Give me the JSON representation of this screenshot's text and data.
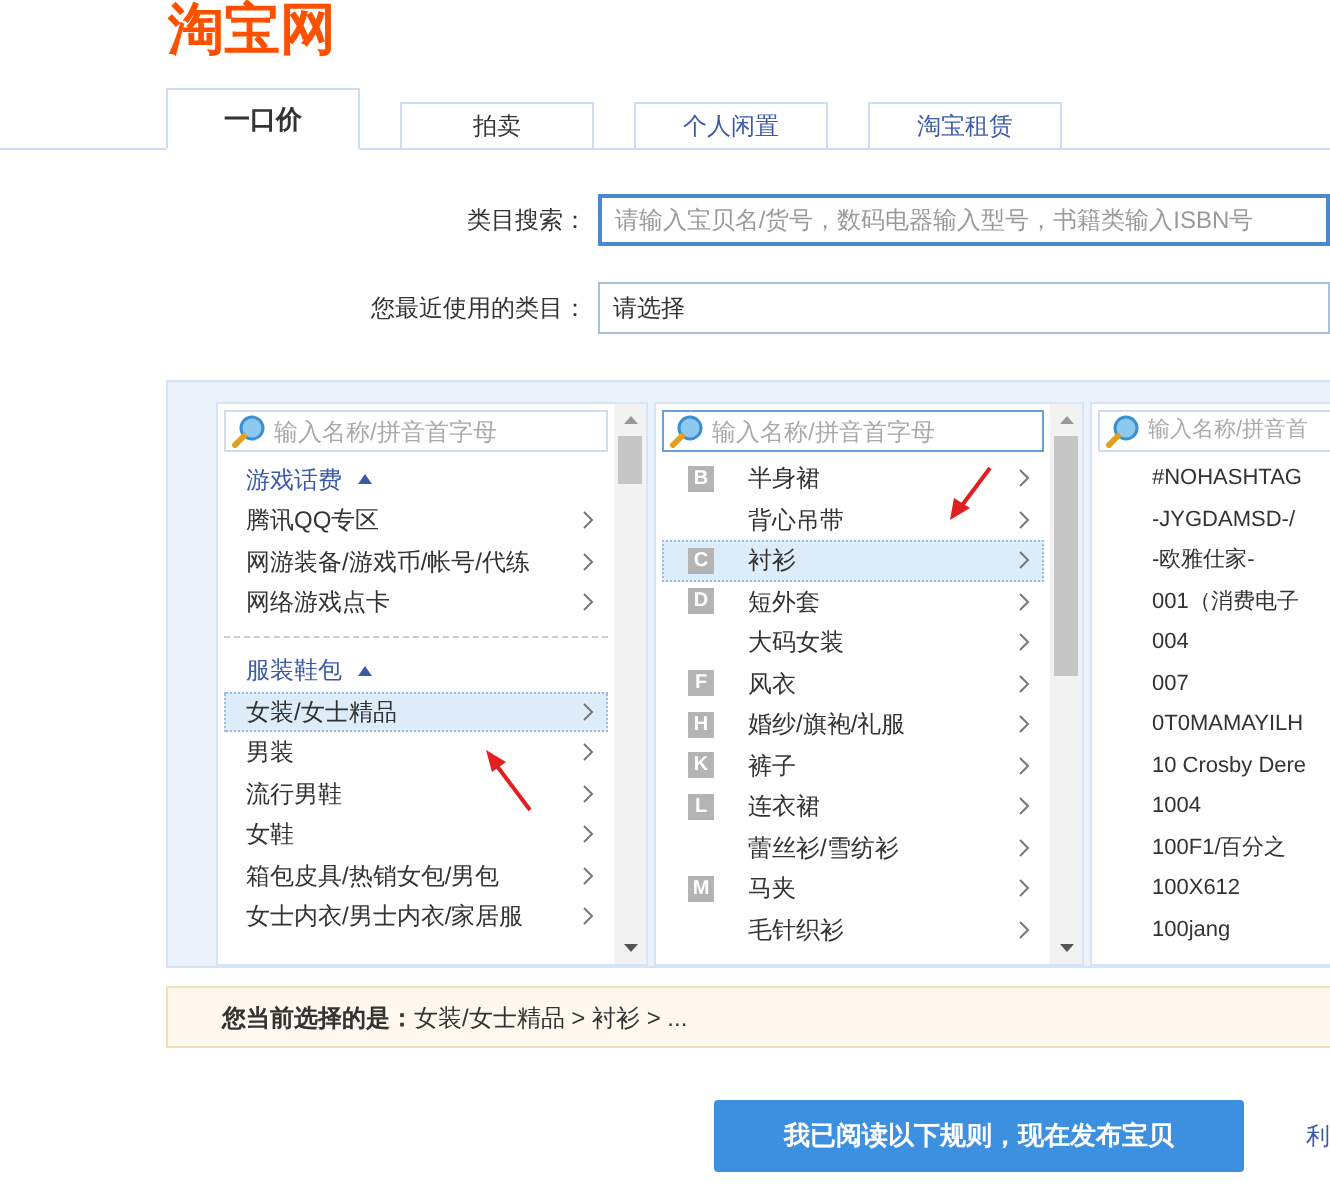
{
  "logo": "淘宝网",
  "tabs": [
    {
      "label": "一口价",
      "selected": true
    },
    {
      "label": "拍卖",
      "selected": false
    },
    {
      "label": "个人闲置",
      "selected": false
    },
    {
      "label": "淘宝租赁",
      "selected": false
    }
  ],
  "category_search": {
    "label": "类目搜索：",
    "placeholder": "请输入宝贝名/货号，数码电器输入型号，书籍类输入ISBN号"
  },
  "recent_category": {
    "label": "您最近使用的类目：",
    "value": "请选择"
  },
  "columns": [
    {
      "search_placeholder": "输入名称/拼音首字母",
      "items": [
        {
          "kind": "group",
          "label": "游戏话费",
          "expanded": true
        },
        {
          "kind": "item",
          "label": "腾讯QQ专区",
          "selected": false
        },
        {
          "kind": "item",
          "label": "网游装备/游戏币/帐号/代练",
          "selected": false
        },
        {
          "kind": "item",
          "label": "网络游戏点卡",
          "selected": false
        },
        {
          "kind": "group",
          "label": "服装鞋包",
          "expanded": true
        },
        {
          "kind": "item",
          "label": "女装/女士精品",
          "selected": true
        },
        {
          "kind": "item",
          "label": "男装",
          "selected": false
        },
        {
          "kind": "item",
          "label": "流行男鞋",
          "selected": false
        },
        {
          "kind": "item",
          "label": "女鞋",
          "selected": false
        },
        {
          "kind": "item",
          "label": "箱包皮具/热销女包/男包",
          "selected": false
        },
        {
          "kind": "item",
          "label": "女士内衣/男士内衣/家居服",
          "selected": false
        }
      ]
    },
    {
      "search_placeholder": "输入名称/拼音首字母",
      "items": [
        {
          "kind": "item",
          "letter": "B",
          "label": "半身裙",
          "selected": false
        },
        {
          "kind": "item",
          "label": "背心吊带",
          "selected": false
        },
        {
          "kind": "item",
          "letter": "C",
          "label": "衬衫",
          "selected": true
        },
        {
          "kind": "item",
          "letter": "D",
          "label": "短外套",
          "selected": false
        },
        {
          "kind": "item",
          "label": "大码女装",
          "selected": false
        },
        {
          "kind": "item",
          "letter": "F",
          "label": "风衣",
          "selected": false
        },
        {
          "kind": "item",
          "letter": "H",
          "label": "婚纱/旗袍/礼服",
          "selected": false
        },
        {
          "kind": "item",
          "letter": "K",
          "label": "裤子",
          "selected": false
        },
        {
          "kind": "item",
          "letter": "L",
          "label": "连衣裙",
          "selected": false
        },
        {
          "kind": "item",
          "label": "蕾丝衫/雪纺衫",
          "selected": false
        },
        {
          "kind": "item",
          "letter": "M",
          "label": "马夹",
          "selected": false
        },
        {
          "kind": "item",
          "label": "毛针织衫",
          "selected": false
        }
      ]
    },
    {
      "search_placeholder": "输入名称/拼音首",
      "items": [
        {
          "kind": "brand",
          "label": "#NOHASHTAG"
        },
        {
          "kind": "brand",
          "label": "-JYGDAMSD-/"
        },
        {
          "kind": "brand",
          "label": "-欧雅仕家-"
        },
        {
          "kind": "brand",
          "label": "001（消费电子"
        },
        {
          "kind": "brand",
          "label": "004"
        },
        {
          "kind": "brand",
          "label": "007"
        },
        {
          "kind": "brand",
          "label": "0T0MAMAYILH"
        },
        {
          "kind": "brand",
          "label": "10 Crosby Dere"
        },
        {
          "kind": "brand",
          "label": "1004"
        },
        {
          "kind": "brand",
          "label": "100F1/百分之"
        },
        {
          "kind": "brand",
          "label": "100X612"
        },
        {
          "kind": "brand",
          "label": "100jang"
        }
      ]
    }
  ],
  "current_selection": {
    "label": "您当前选择的是：",
    "path": "女装/女士精品 > 衬衫 > ..."
  },
  "publish_button": "我已阅读以下规则，现在发布宝贝",
  "side_link": "利"
}
